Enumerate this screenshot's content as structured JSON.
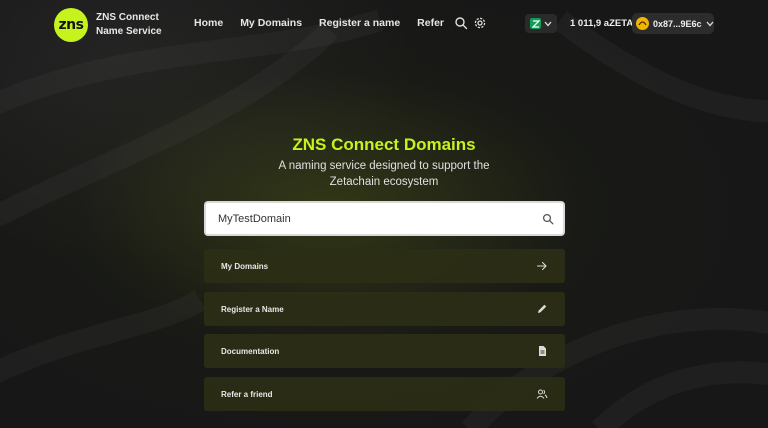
{
  "brand": {
    "logo_text": "zns",
    "name_line1": "ZNS Connect",
    "name_line2": "Name Service",
    "accent_color": "#c6f31e"
  },
  "nav": {
    "items": [
      {
        "label": "Home"
      },
      {
        "label": "My Domains"
      },
      {
        "label": "Register a name"
      },
      {
        "label": "Refer"
      }
    ]
  },
  "header_icons": [
    "search-icon",
    "gear-icon"
  ],
  "wallet": {
    "chain_icon": "zetachain-icon",
    "balance": "1 011,9 aZETA",
    "address": "0x87...9E6c"
  },
  "hero": {
    "title": "ZNS Connect Domains",
    "subtitle_line1": "A naming service designed to support the",
    "subtitle_line2": "Zetachain ecosystem"
  },
  "search": {
    "value": "MyTestDomain"
  },
  "actions": [
    {
      "label": "My Domains",
      "icon": "arrow-right-icon"
    },
    {
      "label": "Register a Name",
      "icon": "pencil-icon"
    },
    {
      "label": "Documentation",
      "icon": "document-icon"
    },
    {
      "label": "Refer a friend",
      "icon": "users-icon"
    }
  ]
}
